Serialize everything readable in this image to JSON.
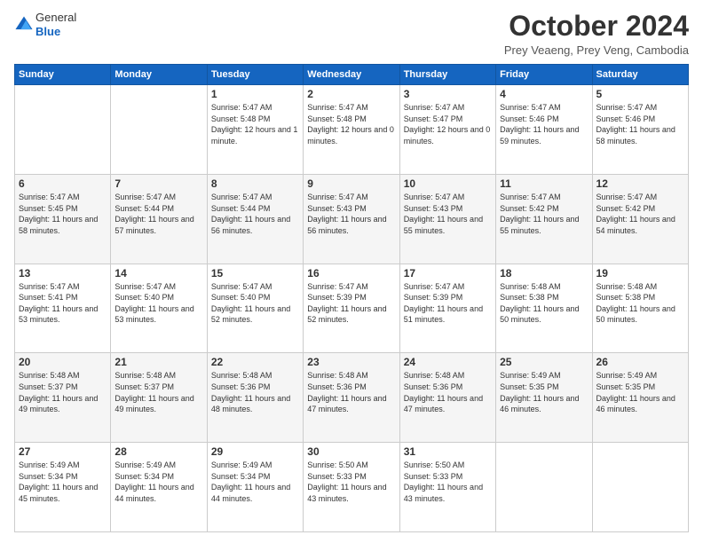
{
  "header": {
    "logo_general": "General",
    "logo_blue": "Blue",
    "month_title": "October 2024",
    "location": "Prey Veaeng, Prey Veng, Cambodia"
  },
  "weekdays": [
    "Sunday",
    "Monday",
    "Tuesday",
    "Wednesday",
    "Thursday",
    "Friday",
    "Saturday"
  ],
  "weeks": [
    [
      {
        "day": "",
        "sunrise": "",
        "sunset": "",
        "daylight": ""
      },
      {
        "day": "",
        "sunrise": "",
        "sunset": "",
        "daylight": ""
      },
      {
        "day": "1",
        "sunrise": "Sunrise: 5:47 AM",
        "sunset": "Sunset: 5:48 PM",
        "daylight": "Daylight: 12 hours and 1 minute."
      },
      {
        "day": "2",
        "sunrise": "Sunrise: 5:47 AM",
        "sunset": "Sunset: 5:48 PM",
        "daylight": "Daylight: 12 hours and 0 minutes."
      },
      {
        "day": "3",
        "sunrise": "Sunrise: 5:47 AM",
        "sunset": "Sunset: 5:47 PM",
        "daylight": "Daylight: 12 hours and 0 minutes."
      },
      {
        "day": "4",
        "sunrise": "Sunrise: 5:47 AM",
        "sunset": "Sunset: 5:46 PM",
        "daylight": "Daylight: 11 hours and 59 minutes."
      },
      {
        "day": "5",
        "sunrise": "Sunrise: 5:47 AM",
        "sunset": "Sunset: 5:46 PM",
        "daylight": "Daylight: 11 hours and 58 minutes."
      }
    ],
    [
      {
        "day": "6",
        "sunrise": "Sunrise: 5:47 AM",
        "sunset": "Sunset: 5:45 PM",
        "daylight": "Daylight: 11 hours and 58 minutes."
      },
      {
        "day": "7",
        "sunrise": "Sunrise: 5:47 AM",
        "sunset": "Sunset: 5:44 PM",
        "daylight": "Daylight: 11 hours and 57 minutes."
      },
      {
        "day": "8",
        "sunrise": "Sunrise: 5:47 AM",
        "sunset": "Sunset: 5:44 PM",
        "daylight": "Daylight: 11 hours and 56 minutes."
      },
      {
        "day": "9",
        "sunrise": "Sunrise: 5:47 AM",
        "sunset": "Sunset: 5:43 PM",
        "daylight": "Daylight: 11 hours and 56 minutes."
      },
      {
        "day": "10",
        "sunrise": "Sunrise: 5:47 AM",
        "sunset": "Sunset: 5:43 PM",
        "daylight": "Daylight: 11 hours and 55 minutes."
      },
      {
        "day": "11",
        "sunrise": "Sunrise: 5:47 AM",
        "sunset": "Sunset: 5:42 PM",
        "daylight": "Daylight: 11 hours and 55 minutes."
      },
      {
        "day": "12",
        "sunrise": "Sunrise: 5:47 AM",
        "sunset": "Sunset: 5:42 PM",
        "daylight": "Daylight: 11 hours and 54 minutes."
      }
    ],
    [
      {
        "day": "13",
        "sunrise": "Sunrise: 5:47 AM",
        "sunset": "Sunset: 5:41 PM",
        "daylight": "Daylight: 11 hours and 53 minutes."
      },
      {
        "day": "14",
        "sunrise": "Sunrise: 5:47 AM",
        "sunset": "Sunset: 5:40 PM",
        "daylight": "Daylight: 11 hours and 53 minutes."
      },
      {
        "day": "15",
        "sunrise": "Sunrise: 5:47 AM",
        "sunset": "Sunset: 5:40 PM",
        "daylight": "Daylight: 11 hours and 52 minutes."
      },
      {
        "day": "16",
        "sunrise": "Sunrise: 5:47 AM",
        "sunset": "Sunset: 5:39 PM",
        "daylight": "Daylight: 11 hours and 52 minutes."
      },
      {
        "day": "17",
        "sunrise": "Sunrise: 5:47 AM",
        "sunset": "Sunset: 5:39 PM",
        "daylight": "Daylight: 11 hours and 51 minutes."
      },
      {
        "day": "18",
        "sunrise": "Sunrise: 5:48 AM",
        "sunset": "Sunset: 5:38 PM",
        "daylight": "Daylight: 11 hours and 50 minutes."
      },
      {
        "day": "19",
        "sunrise": "Sunrise: 5:48 AM",
        "sunset": "Sunset: 5:38 PM",
        "daylight": "Daylight: 11 hours and 50 minutes."
      }
    ],
    [
      {
        "day": "20",
        "sunrise": "Sunrise: 5:48 AM",
        "sunset": "Sunset: 5:37 PM",
        "daylight": "Daylight: 11 hours and 49 minutes."
      },
      {
        "day": "21",
        "sunrise": "Sunrise: 5:48 AM",
        "sunset": "Sunset: 5:37 PM",
        "daylight": "Daylight: 11 hours and 49 minutes."
      },
      {
        "day": "22",
        "sunrise": "Sunrise: 5:48 AM",
        "sunset": "Sunset: 5:36 PM",
        "daylight": "Daylight: 11 hours and 48 minutes."
      },
      {
        "day": "23",
        "sunrise": "Sunrise: 5:48 AM",
        "sunset": "Sunset: 5:36 PM",
        "daylight": "Daylight: 11 hours and 47 minutes."
      },
      {
        "day": "24",
        "sunrise": "Sunrise: 5:48 AM",
        "sunset": "Sunset: 5:36 PM",
        "daylight": "Daylight: 11 hours and 47 minutes."
      },
      {
        "day": "25",
        "sunrise": "Sunrise: 5:49 AM",
        "sunset": "Sunset: 5:35 PM",
        "daylight": "Daylight: 11 hours and 46 minutes."
      },
      {
        "day": "26",
        "sunrise": "Sunrise: 5:49 AM",
        "sunset": "Sunset: 5:35 PM",
        "daylight": "Daylight: 11 hours and 46 minutes."
      }
    ],
    [
      {
        "day": "27",
        "sunrise": "Sunrise: 5:49 AM",
        "sunset": "Sunset: 5:34 PM",
        "daylight": "Daylight: 11 hours and 45 minutes."
      },
      {
        "day": "28",
        "sunrise": "Sunrise: 5:49 AM",
        "sunset": "Sunset: 5:34 PM",
        "daylight": "Daylight: 11 hours and 44 minutes."
      },
      {
        "day": "29",
        "sunrise": "Sunrise: 5:49 AM",
        "sunset": "Sunset: 5:34 PM",
        "daylight": "Daylight: 11 hours and 44 minutes."
      },
      {
        "day": "30",
        "sunrise": "Sunrise: 5:50 AM",
        "sunset": "Sunset: 5:33 PM",
        "daylight": "Daylight: 11 hours and 43 minutes."
      },
      {
        "day": "31",
        "sunrise": "Sunrise: 5:50 AM",
        "sunset": "Sunset: 5:33 PM",
        "daylight": "Daylight: 11 hours and 43 minutes."
      },
      {
        "day": "",
        "sunrise": "",
        "sunset": "",
        "daylight": ""
      },
      {
        "day": "",
        "sunrise": "",
        "sunset": "",
        "daylight": ""
      }
    ]
  ]
}
